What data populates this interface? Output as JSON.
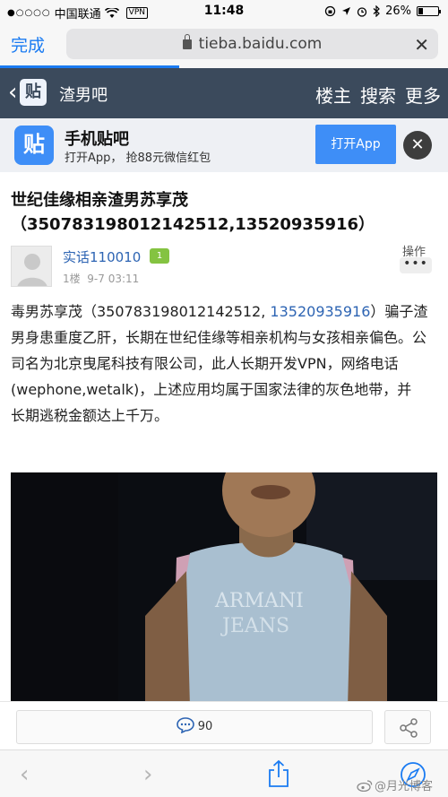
{
  "status_bar": {
    "carrier": "中国联通",
    "vpn": "VPN",
    "time": "11:48",
    "battery_percent": "26%",
    "battery_level": 0.26
  },
  "browser": {
    "done_label": "完成",
    "url": "tieba.baidu.com",
    "close_icon": "close-icon",
    "progress": 0.4,
    "accent_color": "#1a7bf2"
  },
  "forum_header": {
    "logo_char": "贴",
    "forum_name": "渣男吧",
    "actions": [
      "楼主",
      "搜索",
      "更多"
    ],
    "bg_color": "#3b4a5c"
  },
  "app_banner": {
    "logo_char": "贴",
    "title": "手机贴吧",
    "subtitle": "打开App， 抢88元微信红包",
    "open_button": "打开App"
  },
  "post": {
    "title_line1": "世纪佳缘相亲渣男苏享茂",
    "title_line2": "（35078319801214251​2,13520935916）",
    "author": "实话110010",
    "level": "1",
    "floor": "1楼",
    "date": "9-7 03:11",
    "op_label": "操作",
    "op_dots": "•••",
    "body_prefix": "毒男苏享茂（350783198012142512, ",
    "body_phone": "13520935916",
    "body_rest": "）骗子渣男身患重度乙肝，长期在世纪佳缘等相亲机构与女孩相亲偏色。公司名为北京曳尾科技有限公司，此人长期开发VPN，网络电话(wephone,wetalk)，上述应用均属于国家法律的灰色地带，并",
    "body_last": "长期逃税金额达上千万。",
    "photo_shirt_text": "ARMANI JEANS"
  },
  "reply_bar": {
    "comment_count": "90"
  },
  "watermark": "@月光博客"
}
